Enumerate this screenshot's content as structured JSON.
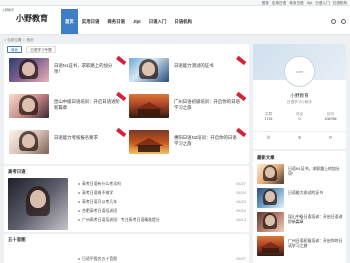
{
  "topbar": {
    "links": [
      "登录",
      "应用日语",
      "商务日语",
      "Jlpt",
      "日语入门",
      "日语机构"
    ]
  },
  "header": {
    "logo_alt": "小野教育",
    "logo_text": "小野教育",
    "nav": [
      "首页",
      "实用日语",
      "商务日语",
      "Jlpt",
      "日语入门",
      "日语机构"
    ]
  },
  "breadcrumb": {
    "home": "⌂ 当前位置",
    "sep": "|",
    "current": "首页"
  },
  "main": {
    "tabs": [
      "最新",
      "日语学习专题"
    ],
    "cards": [
      {
        "title": "日语N1证书，求职路上的加分项！"
      },
      {
        "title": "日语能力测试的证书"
      },
      {
        "title": "昆山中级日语培训：开启日语进阶新篇章"
      },
      {
        "title": "广州日语初级培训：开启你的日语学习之旅"
      },
      {
        "title": "日语能力考核报名要求"
      },
      {
        "title": "惠阳日语N2培训：开启你的日语学习之旅"
      }
    ]
  },
  "section1": {
    "heading": "高考日语",
    "items": [
      {
        "title": "高考日语有什么考试吗",
        "date": "06/27"
      },
      {
        "title": "高考日语难不难学",
        "date": "06/24"
      },
      {
        "title": "高考日语可以考几年",
        "date": "06/23"
      },
      {
        "title": "合肥高考日语培训班",
        "date": "06/16"
      },
      {
        "title": "广州高考日语培训班：专注高考日语精准提分",
        "date": "06/12"
      }
    ]
  },
  "section2": {
    "heading": "五十音图",
    "items": [
      {
        "title": "日语平假名五十音图",
        "date": "06/27"
      }
    ]
  },
  "profile": {
    "cover_label": "cover",
    "name": "小野教育",
    "desc": "日语学习小助手",
    "stats": [
      {
        "label": "文章",
        "value": "1724"
      },
      {
        "label": "评论",
        "value": "0"
      },
      {
        "label": "访问",
        "value": "108786"
      }
    ],
    "actions": [
      "☰",
      "⊕",
      "✉"
    ]
  },
  "sidebar": {
    "heading": "最新文章",
    "items": [
      {
        "title": "日语N1证书，求职路上的加分项！"
      },
      {
        "title": "日语能力测试的证书"
      },
      {
        "title": "昆山中级日语培训：开启日语进阶新篇章"
      },
      {
        "title": "广州日语初级培训：开启你的日语学习之旅"
      }
    ]
  }
}
